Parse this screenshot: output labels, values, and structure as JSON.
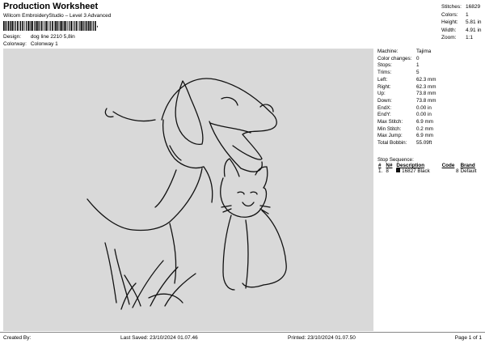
{
  "header": {
    "title": "Production Worksheet",
    "subtitle": "Wilcom EmbroideryStudio – Level 3 Advanced",
    "barcode_suffix": ","
  },
  "info": {
    "design_label": "Design:",
    "design_value": "dog line 2210 5,8in",
    "colorway_label": "Colorway:",
    "colorway_value": "Colonway 1"
  },
  "stats": [
    {
      "label": "Stitches:",
      "value": "16829"
    },
    {
      "label": "Colors:",
      "value": "1"
    },
    {
      "label": "Height:",
      "value": "5.81 in"
    },
    {
      "label": "Width:",
      "value": "4.91 in"
    },
    {
      "label": "Zoom:",
      "value": "1:1"
    }
  ],
  "params": [
    {
      "label": "Machine:",
      "value": "Tajima"
    },
    {
      "label": "Color changes:",
      "value": "0"
    },
    {
      "label": "Stops:",
      "value": "1"
    },
    {
      "label": "Trims:",
      "value": "5"
    },
    {
      "label": "Left:",
      "value": "62.3 mm"
    },
    {
      "label": "Right:",
      "value": "62.3 mm"
    },
    {
      "label": "Up:",
      "value": "73.8 mm"
    },
    {
      "label": "Down:",
      "value": "73.8 mm"
    },
    {
      "label": "EndX:",
      "value": "0.00 in"
    },
    {
      "label": "EndY:",
      "value": "0.00 in"
    },
    {
      "label": "Max Stitch:",
      "value": "6.9 mm"
    },
    {
      "label": "Min Stitch:",
      "value": "0.2 mm"
    },
    {
      "label": "Max Jump:",
      "value": "6.9 mm"
    },
    {
      "label": "Total Bobbin:",
      "value": "55.09ft"
    }
  ],
  "stop_sequence": {
    "title": "Stop Sequence:",
    "headers": [
      "#",
      "N#",
      "Description",
      "Code",
      "Brand"
    ],
    "rows": [
      {
        "num": "1.",
        "n": "8",
        "code_id": "16827",
        "description": "Black",
        "code": "8",
        "brand": "Default",
        "color": "#111111"
      }
    ]
  },
  "footer": {
    "created_by": "Created By:",
    "last_saved": "Last Saved: 23/10/2024 01.07.46",
    "printed": "Printed: 23/10/2024 01.07.50",
    "page": "Page 1 of 1"
  }
}
